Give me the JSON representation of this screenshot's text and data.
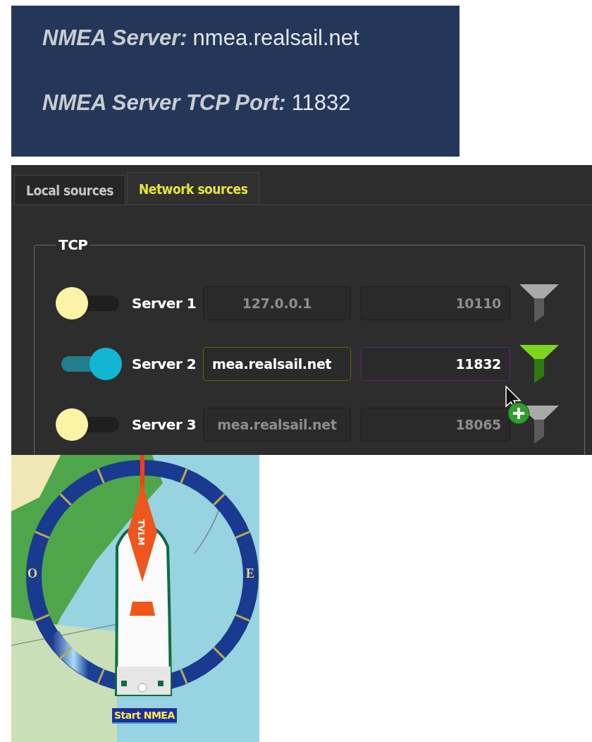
{
  "server_info": [
    {
      "label": "NMEA Server:",
      "value": "nmea.realsail.net"
    },
    {
      "label": "NMEA Server TCP Port:",
      "value": "11832"
    }
  ],
  "tabs": [
    {
      "label": "Local sources",
      "selected": false
    },
    {
      "label": "Network sources",
      "selected": true
    }
  ],
  "tcp_group": {
    "title": "TCP",
    "servers": [
      {
        "name": "Server 1",
        "on": false,
        "host": "127.0.0.1",
        "port": "10110"
      },
      {
        "name": "Server 2",
        "on": true,
        "host": "mea.realsail.net",
        "port": "11832"
      },
      {
        "name": "Server 3",
        "on": false,
        "host": "mea.realsail.net",
        "port": "18065"
      }
    ]
  },
  "map": {
    "compass_labels": [
      "O",
      "E"
    ],
    "sail_label": "TVLM",
    "start_button": "Start NMEA"
  }
}
